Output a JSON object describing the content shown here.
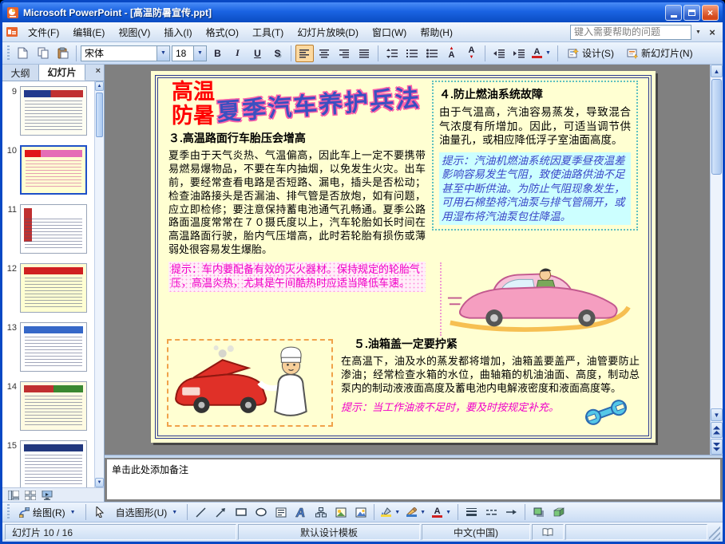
{
  "window": {
    "title": "Microsoft PowerPoint - [高温防暑宣传.ppt]"
  },
  "icons": {
    "close_x": "×",
    "dropdown": "▼",
    "up_arrow": "▲",
    "down_arrow": "▼"
  },
  "menu": {
    "items": [
      "文件(F)",
      "编辑(E)",
      "视图(V)",
      "插入(I)",
      "格式(O)",
      "工具(T)",
      "幻灯片放映(D)",
      "窗口(W)",
      "帮助(H)"
    ],
    "help_placeholder": "键入需要帮助的问题"
  },
  "format_toolbar": {
    "font_name": "宋体",
    "font_size": "18",
    "bold": "B",
    "italic": "I",
    "underline": "U",
    "shadow": "S",
    "letter_a": "A",
    "design_label": "设计(S)",
    "new_slide_label": "新幻灯片(N)"
  },
  "slides_panel": {
    "tab_outline": "大纲",
    "tab_slides": "幻灯片",
    "numbers": [
      "9",
      "10",
      "11",
      "12",
      "13",
      "14",
      "15"
    ],
    "selected_number": "10"
  },
  "slide": {
    "title_line1": "高温",
    "title_line2": "防暑",
    "banner": "夏季汽车养护兵法",
    "sec3_heading": "３.高温路面行车胎压会增高",
    "sec3_body": "夏季由于天气炎热、气温偏高，因此车上一定不要携带易燃易爆物品，不要在车内抽烟，以免发生火灾。出车前，要经常查看电路是否短路、漏电，插头是否松动；检查油路接头是否漏油、排气管是否放炮，如有问题，应立即检修；要注意保持蓄电池通气孔畅通。夏季公路路面温度常常在７０摄氏度以上，汽车轮胎如长时间在高温路面行驶，胎内气压增高，此时若轮胎有损伤或薄弱处很容易发生爆胎。",
    "sec3_tip": "提示：车内要配备有效的灭火器材。保持规定的轮胎气压，高温炎热，尤其是午间酷热时应适当降低车速。",
    "sec4_heading": "４.防止燃油系统故障",
    "sec4_body": "由于气温高，汽油容易蒸发，导致混合气浓度有所增加。因此，可适当调节供油量孔，或相应降低浮子室油面高度。",
    "sec4_tip": "提示：汽油机燃油系统因夏季昼夜温差影响容易发生气阻，致使油路供油不足甚至中断供油。为防止气阻现象发生，可用石棉垫将汽油泵与排气管隔开，或用湿布将汽油泵包住降温。",
    "sec5_heading": "５.油箱盖一定要拧紧",
    "sec5_body": "在高温下，油及水的蒸发都将增加，油箱盖要盖严，油管要防止渗油；经常检查水箱的水位，曲轴箱的机油油面、高度，制动总泵内的制动液液面高度及蓄电池内电解液密度和液面高度等。",
    "sec5_tip": "提示：当工作油液不足时，要及时按规定补充。"
  },
  "notes": {
    "placeholder": "单击此处添加备注"
  },
  "drawing_toolbar": {
    "draw_label": "绘图(R)",
    "autoshapes_label": "自选图形(U)"
  },
  "status_bar": {
    "slide_info": "幻灯片 10 / 16",
    "design_template": "默认设计模板",
    "language": "中文(中国)"
  },
  "colors": {
    "titlebar_blue": "#1a63e2",
    "slide_bg": "#ffffd2",
    "accent_red": "#ff0000",
    "tip_magenta": "#f000c8",
    "tip_blue": "#3a46c8",
    "sec4_cyan": "#ccffff"
  }
}
